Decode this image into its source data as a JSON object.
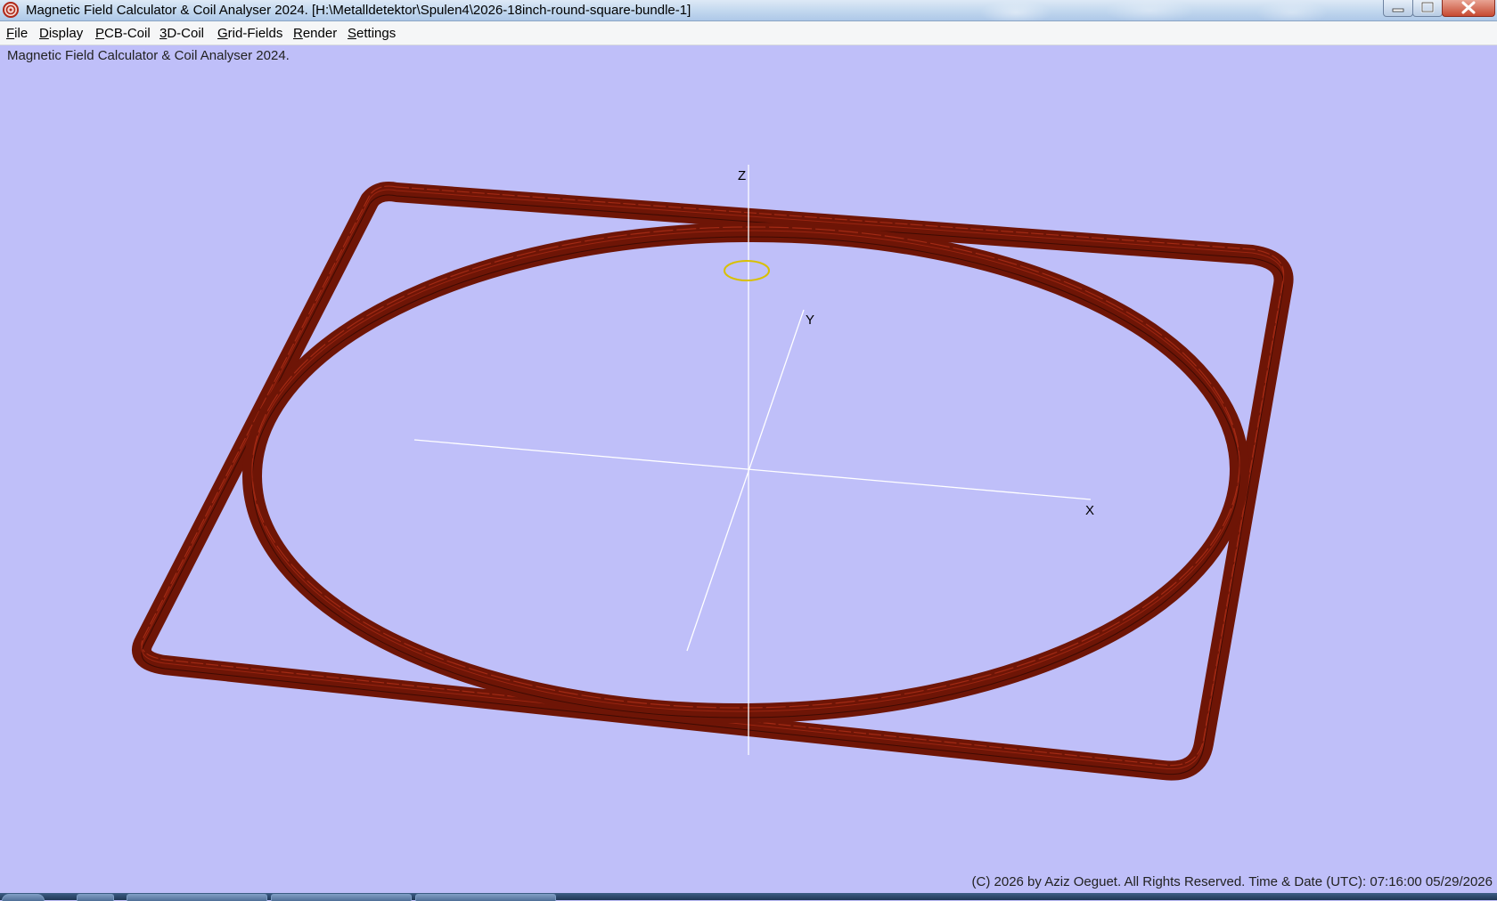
{
  "window": {
    "title": "Magnetic Field Calculator & Coil Analyser 2024.  [H:\\Metalldetektor\\Spulen4\\2026-18inch-round-square-bundle-1]"
  },
  "menu": {
    "file": {
      "first": "F",
      "rest": "ile"
    },
    "display": {
      "first": "D",
      "rest": "isplay"
    },
    "pcb_coil": {
      "first": "P",
      "rest": "CB-Coil"
    },
    "coil3d": {
      "first": "3",
      "rest": "D-Coil"
    },
    "grid_fields": {
      "first": "G",
      "rest": "rid-Fields"
    },
    "render": {
      "first": "R",
      "rest": "ender"
    },
    "settings": {
      "first": "S",
      "rest": "ettings"
    }
  },
  "status_top": "Magnetic Field Calculator & Coil Analyser 2024.",
  "axes": {
    "x": "X",
    "y": "Y",
    "z": "Z"
  },
  "footer": "(C) 2026  by Aziz Oeguet. All Rights Reserved.  Time & Date (UTC): 07:16:00  05/29/2026",
  "colors": {
    "background": "#bfbff9",
    "coil": "#7a1808",
    "coil_stripe": "#a42a14",
    "axis": "#ffffff",
    "marker": "#d8c000"
  },
  "icons": [
    "app-icon",
    "minimize-icon",
    "maximize-icon",
    "close-icon"
  ]
}
